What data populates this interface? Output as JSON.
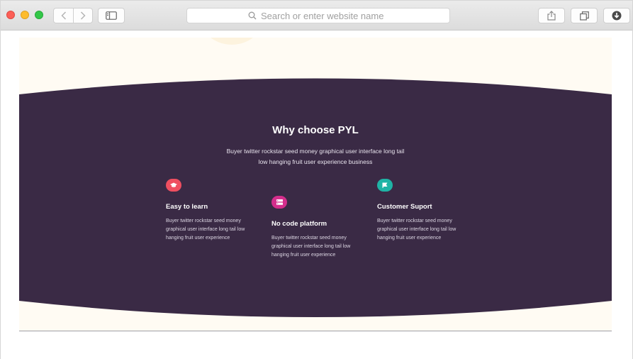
{
  "browser": {
    "address_placeholder": "Search or enter website name",
    "colors": {
      "toolbar": "#e2e2e2",
      "close": "#fc5f57",
      "minimize": "#fdbc2e",
      "zoom": "#33c748"
    },
    "icons": [
      "back-icon",
      "forward-icon",
      "sidebar-icon",
      "search-icon",
      "share-icon",
      "tabs-icon",
      "download-icon"
    ]
  },
  "section": {
    "title": "Why choose PYL",
    "subtitle": "Buyer twitter rockstar seed money graphical user interface long tail low hanging fruit user experience business",
    "colors": {
      "band": "#3a2a45",
      "page_bg": "#fffbf3"
    }
  },
  "features": [
    {
      "title": "Easy to learn",
      "description": "Buyer twitter rockstar seed money graphical user interface long tail low hanging fruit user experience",
      "icon": "graduation-cap-icon",
      "color": "#ef4f60"
    },
    {
      "title": "No code platform",
      "description": "Buyer twitter rockstar seed money graphical user interface long tail low hanging fruit user experience",
      "icon": "server-icon",
      "color": "#d42e8c"
    },
    {
      "title": "Customer Suport",
      "description": "Buyer twitter rockstar seed money graphical user interface long tail low hanging fruit user experience",
      "icon": "flag-icon",
      "color": "#1fb3a5"
    }
  ]
}
